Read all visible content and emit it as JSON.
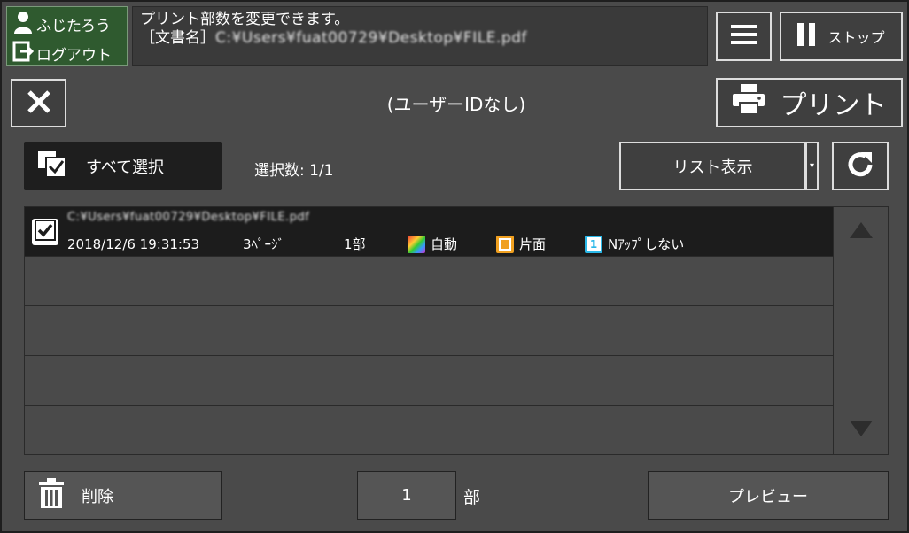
{
  "user": {
    "name": "ふじたろう",
    "logout": "ログアウト"
  },
  "message": {
    "line1": "プリント部数を変更できます。",
    "doc_label": "［文書名］",
    "doc_name": "C:¥Users¥fuat00729¥Desktop¥FILE.pdf"
  },
  "header": {
    "stop_label": "ストップ",
    "title": "(ユーザーIDなし)",
    "print_label": "プリント"
  },
  "toolbar": {
    "select_all": "すべて選択",
    "selection_count": "選択数:  1/1",
    "list_view": "リスト表示",
    "dropdown_caret": "▾"
  },
  "jobs": [
    {
      "file": "C:¥Users¥fuat00729¥Desktop¥FILE.pdf",
      "date": "2018/12/6  19:31:53",
      "pages": "3ﾍﾟｰｼﾞ",
      "copies": "1部",
      "color": "自動",
      "sides": "片面",
      "nup_badge": "1",
      "nup": "Nｱｯﾌﾟしない",
      "selected": true
    }
  ],
  "footer": {
    "delete_label": "削除",
    "copies_value": "1",
    "copies_unit": "部",
    "preview_label": "プレビュー"
  },
  "colors": {
    "user_bg": "#2f5a2f",
    "selected_row": "#1c1c1c",
    "badge_orange": "#f0a020",
    "badge_cyan": "#2ab8e8"
  }
}
